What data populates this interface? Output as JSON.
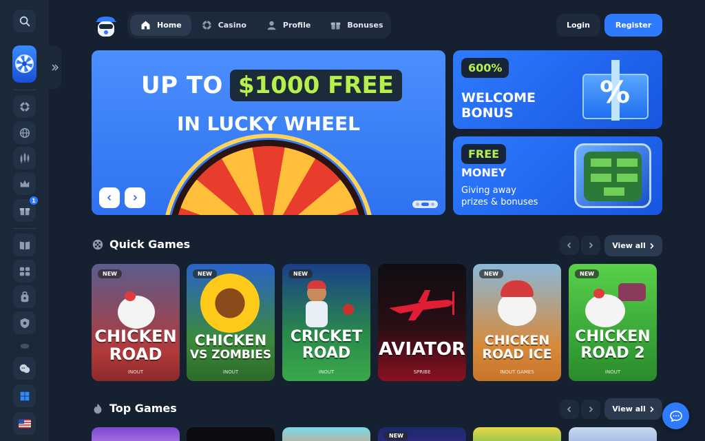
{
  "nav": {
    "items": [
      {
        "label": "Home",
        "icon": "home-icon",
        "active": true
      },
      {
        "label": "Casino",
        "icon": "chip-icon",
        "active": false
      },
      {
        "label": "Profile",
        "icon": "user-icon",
        "active": false
      },
      {
        "label": "Bonuses",
        "icon": "gift-icon",
        "active": false
      }
    ],
    "login_label": "Login",
    "register_label": "Register"
  },
  "sidebar": {
    "badge_count": "1",
    "icons": [
      "search-icon",
      "lucky-wheel-promo",
      "poker-chip-icon",
      "globe-icon",
      "candles-icon",
      "crown-icon",
      "gift-icon",
      "book-icon",
      "slots-icon",
      "bag-icon",
      "shield-icon",
      "coins-icon",
      "chat-bubbles-icon",
      "windows-icon",
      "flag-us-icon"
    ]
  },
  "hero": {
    "line1_prefix": "UP TO",
    "line1_highlight": "$1000 FREE",
    "line2": "IN LUCKY WHEEL"
  },
  "promos": [
    {
      "chip": "600%",
      "title_line1": "WELCOME",
      "title_line2": "BONUS"
    },
    {
      "chip": "FREE",
      "title_line1": "MONEY",
      "desc_line1": "Giving away",
      "desc_line2": "prizes & bonuses"
    }
  ],
  "sections": {
    "quick_games": {
      "title": "Quick Games",
      "view_all": "View all"
    },
    "top_games": {
      "title": "Top Games",
      "view_all": "View all"
    }
  },
  "quick_games": [
    {
      "badge": "NEW",
      "title_line1": "CHICKEN",
      "title_line2": "ROAD",
      "provider": "INOUT"
    },
    {
      "badge": "NEW",
      "title_line1": "CHICKEN",
      "title_line2": "VS ZOMBIES",
      "provider": "INOUT"
    },
    {
      "badge": "NEW",
      "title_line1": "CRICKET",
      "title_line2": "ROAD",
      "provider": "INOUT"
    },
    {
      "badge": "",
      "title_line1": "AVIATOR",
      "title_line2": "",
      "provider": "SPRIBE"
    },
    {
      "badge": "NEW",
      "title_line1": "CHICKEN",
      "title_line2": "ROAD ICE",
      "provider": "INOUT GAMES"
    },
    {
      "badge": "NEW",
      "title_line1": "CHICKEN",
      "title_line2": "ROAD 2",
      "provider": "INOUT"
    }
  ],
  "top_games": [
    {
      "badge": ""
    },
    {
      "badge": ""
    },
    {
      "badge": ""
    },
    {
      "badge": "NEW"
    },
    {
      "badge": ""
    },
    {
      "badge": ""
    }
  ],
  "colors": {
    "background": "#152030",
    "accent_blue": "#2f7bff",
    "promo_green": "#b7f04a"
  }
}
